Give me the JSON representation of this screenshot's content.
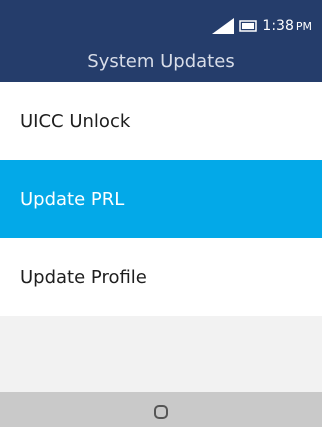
{
  "status_bar": {
    "time": "1:38",
    "ampm": "PM",
    "signal_icon": "signal-icon",
    "battery_icon": "battery-icon"
  },
  "header": {
    "title": "System Updates"
  },
  "menu": {
    "items": [
      {
        "label": "UICC Unlock",
        "selected": false
      },
      {
        "label": "Update PRL",
        "selected": true
      },
      {
        "label": "Update Profile",
        "selected": false
      }
    ]
  },
  "softkeys": {
    "center_icon": "center-key-icon"
  },
  "colors": {
    "header_bg": "#253d6b",
    "selection": "#03a9e8",
    "softkey_bg": "#c9c9c9"
  }
}
